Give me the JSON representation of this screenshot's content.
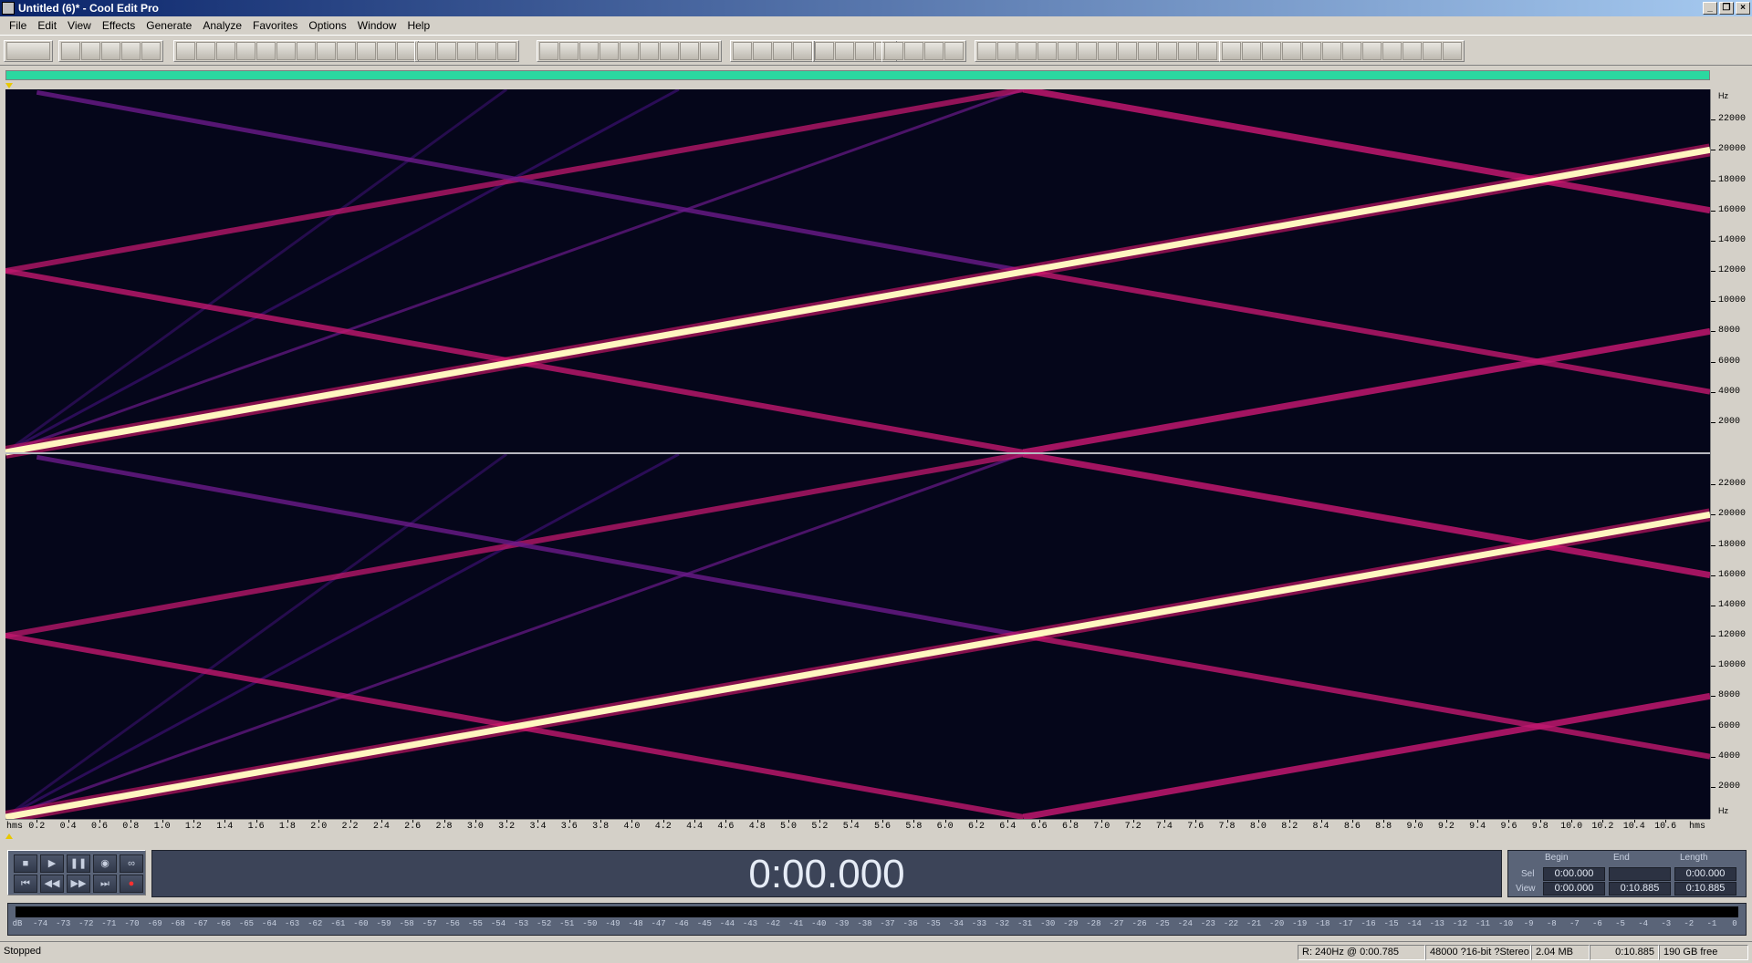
{
  "window": {
    "title": "Untitled (6)* - Cool Edit Pro",
    "app_icon": "cool-edit-pro-icon",
    "buttons": [
      "minimize",
      "restore",
      "close"
    ]
  },
  "menu": [
    "File",
    "Edit",
    "View",
    "Effects",
    "Generate",
    "Analyze",
    "Favorites",
    "Options",
    "Window",
    "Help"
  ],
  "spectrogram": {
    "channels": 2,
    "frequency_axis": {
      "unit": "Hz",
      "labels": [
        "22000",
        "20000",
        "18000",
        "16000",
        "14000",
        "12000",
        "10000",
        "8000",
        "6000",
        "4000",
        "2000"
      ]
    },
    "time_axis": {
      "first_label": "hms",
      "last_label": "hms",
      "labels": [
        "0.2",
        "0.4",
        "0.6",
        "0.8",
        "1.0",
        "1.2",
        "1.4",
        "1.6",
        "1.8",
        "2.0",
        "2.2",
        "2.4",
        "2.6",
        "2.8",
        "3.0",
        "3.2",
        "3.4",
        "3.6",
        "3.8",
        "4.0",
        "4.2",
        "4.4",
        "4.6",
        "4.8",
        "5.0",
        "5.2",
        "5.4",
        "5.6",
        "5.8",
        "6.0",
        "6.2",
        "6.4",
        "6.6",
        "6.8",
        "7.0",
        "7.2",
        "7.4",
        "7.6",
        "7.8",
        "8.0",
        "8.2",
        "8.4",
        "8.6",
        "8.8",
        "9.0",
        "9.2",
        "9.4",
        "9.6",
        "9.8",
        "10.0",
        "10.2",
        "10.4",
        "10.6"
      ]
    },
    "colors": {
      "background": "#05061a",
      "main_sweep": "#fff6c0",
      "alias_strong": "#c0186e",
      "alias_weak": "#6a1a8a",
      "alias_faint": "#3a1070"
    }
  },
  "transport": {
    "row1": [
      "stop-icon",
      "play-icon",
      "pause-icon",
      "play-to-end-icon",
      "loop-icon"
    ],
    "row2": [
      "go-to-start-icon",
      "rewind-icon",
      "fast-forward-icon",
      "go-to-end-icon",
      "record-icon"
    ]
  },
  "time_display": "0:00.000",
  "selection_view": {
    "headers": [
      "Begin",
      "End",
      "Length"
    ],
    "rows": [
      {
        "label": "Sel",
        "begin": "0:00.000",
        "end": "",
        "length": "0:00.000"
      },
      {
        "label": "View",
        "begin": "0:00.000",
        "end": "0:10.885",
        "length": "0:10.885"
      }
    ]
  },
  "level_meter": {
    "labels": [
      "dB",
      "-74",
      "-73",
      "-72",
      "-71",
      "-70",
      "-69",
      "-68",
      "-67",
      "-66",
      "-65",
      "-64",
      "-63",
      "-62",
      "-61",
      "-60",
      "-59",
      "-58",
      "-57",
      "-56",
      "-55",
      "-54",
      "-53",
      "-52",
      "-51",
      "-50",
      "-49",
      "-48",
      "-47",
      "-46",
      "-45",
      "-44",
      "-43",
      "-42",
      "-41",
      "-40",
      "-39",
      "-38",
      "-37",
      "-36",
      "-35",
      "-34",
      "-33",
      "-32",
      "-31",
      "-30",
      "-29",
      "-28",
      "-27",
      "-26",
      "-25",
      "-24",
      "-23",
      "-22",
      "-21",
      "-20",
      "-19",
      "-18",
      "-17",
      "-16",
      "-15",
      "-14",
      "-13",
      "-12",
      "-11",
      "-10",
      "-9",
      "-8",
      "-7",
      "-6",
      "-5",
      "-4",
      "-3",
      "-2",
      "-1",
      "0"
    ]
  },
  "status": {
    "state": "Stopped",
    "cursor_info": "R: 240Hz @   0:00.785",
    "format": "48000 ?16-bit ?Stereo",
    "file_size": "2.04 MB",
    "duration": "0:10.885",
    "disk_free": "190 GB free"
  }
}
